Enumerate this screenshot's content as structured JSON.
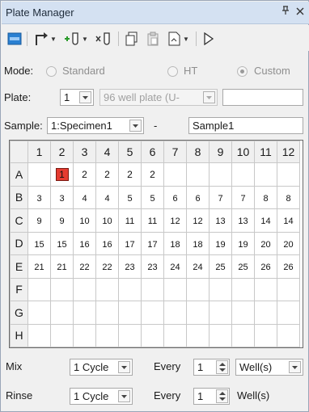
{
  "window": {
    "title": "Plate Manager",
    "pin_glyph": "ȩ",
    "close_glyph": "×"
  },
  "toolbar": {
    "icons": [
      "plate-icon",
      "move-arrow-icon",
      "add-well-icon",
      "remove-well-icon",
      "copy-icon",
      "paste-icon",
      "export-icon",
      "play-icon"
    ]
  },
  "mode": {
    "label": "Mode:",
    "options": [
      {
        "label": "Standard",
        "selected": false
      },
      {
        "label": "HT",
        "selected": false
      },
      {
        "label": "Custom",
        "selected": true
      }
    ]
  },
  "plate": {
    "label": "Plate:",
    "number": "1",
    "type": "96 well plate (U-",
    "name": ""
  },
  "sample": {
    "label": "Sample:",
    "selected": "1:Specimen1",
    "separator": "-",
    "name": "Sample1"
  },
  "grid": {
    "columns": [
      "1",
      "2",
      "3",
      "4",
      "5",
      "6",
      "7",
      "8",
      "9",
      "10",
      "11",
      "12"
    ],
    "rows": [
      "A",
      "B",
      "C",
      "D",
      "E",
      "F",
      "G",
      "H"
    ],
    "values": [
      [
        "",
        "1",
        "2",
        "2",
        "2",
        "2",
        "",
        "",
        "",
        "",
        "",
        ""
      ],
      [
        "3",
        "3",
        "4",
        "4",
        "5",
        "5",
        "6",
        "6",
        "7",
        "7",
        "8",
        "8"
      ],
      [
        "9",
        "9",
        "10",
        "10",
        "11",
        "11",
        "12",
        "12",
        "13",
        "13",
        "14",
        "14"
      ],
      [
        "15",
        "15",
        "16",
        "16",
        "17",
        "17",
        "18",
        "18",
        "19",
        "19",
        "20",
        "20"
      ],
      [
        "21",
        "21",
        "22",
        "22",
        "23",
        "23",
        "24",
        "24",
        "25",
        "25",
        "26",
        "26"
      ],
      [
        "",
        "",
        "",
        "",
        "",
        "",
        "",
        "",
        "",
        "",
        "",
        ""
      ],
      [
        "",
        "",
        "",
        "",
        "",
        "",
        "",
        "",
        "",
        "",
        "",
        ""
      ],
      [
        "",
        "",
        "",
        "",
        "",
        "",
        "",
        "",
        "",
        "",
        "",
        ""
      ]
    ],
    "selected_well": "A2",
    "selected_color": "#e53b30"
  },
  "mix": {
    "label": "Mix",
    "cycle": "1 Cycle",
    "every_label": "Every",
    "every_value": "1",
    "unit": "Well(s)"
  },
  "rinse": {
    "label": "Rinse",
    "cycle": "1 Cycle",
    "every_label": "Every",
    "every_value": "1",
    "unit": "Well(s)"
  }
}
